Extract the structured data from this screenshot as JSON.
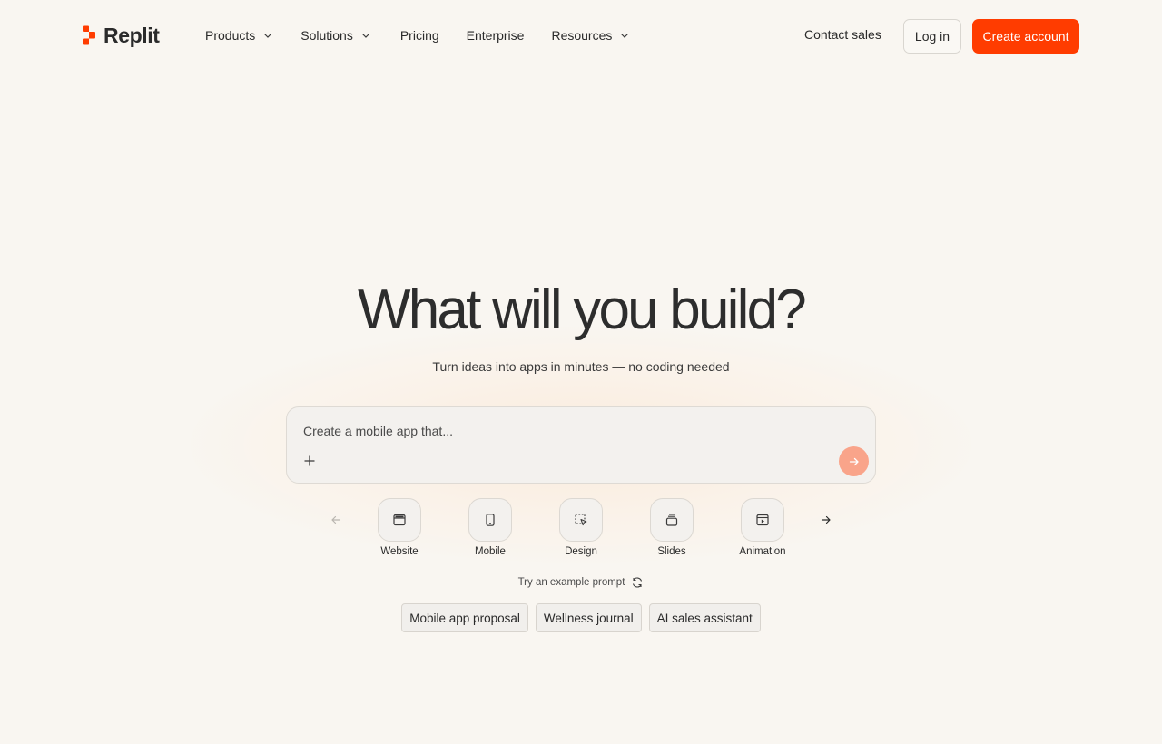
{
  "brand": {
    "name": "Replit",
    "accent_color": "#ff3c00"
  },
  "nav": {
    "items": [
      {
        "label": "Products",
        "has_dropdown": true
      },
      {
        "label": "Solutions",
        "has_dropdown": true
      },
      {
        "label": "Pricing",
        "has_dropdown": false
      },
      {
        "label": "Enterprise",
        "has_dropdown": false
      },
      {
        "label": "Resources",
        "has_dropdown": true
      }
    ],
    "contact_label": "Contact sales",
    "login_label": "Log in",
    "create_account_label": "Create account"
  },
  "hero": {
    "title": "What will you build?",
    "subtitle": "Turn ideas into apps in minutes — no coding needed",
    "prompt_placeholder": "Create a mobile app that..."
  },
  "categories": [
    {
      "label": "Website",
      "icon": "browser-window-icon"
    },
    {
      "label": "Mobile",
      "icon": "phone-icon"
    },
    {
      "label": "Design",
      "icon": "select-cursor-icon"
    },
    {
      "label": "Slides",
      "icon": "slides-stack-icon"
    },
    {
      "label": "Animation",
      "icon": "video-play-icon"
    }
  ],
  "examples": {
    "label": "Try an example prompt",
    "chips": [
      "Mobile app proposal",
      "Wellness journal",
      "AI sales assistant"
    ]
  },
  "colors": {
    "background": "#f9f6f1",
    "send_button": "#f9a48a"
  }
}
